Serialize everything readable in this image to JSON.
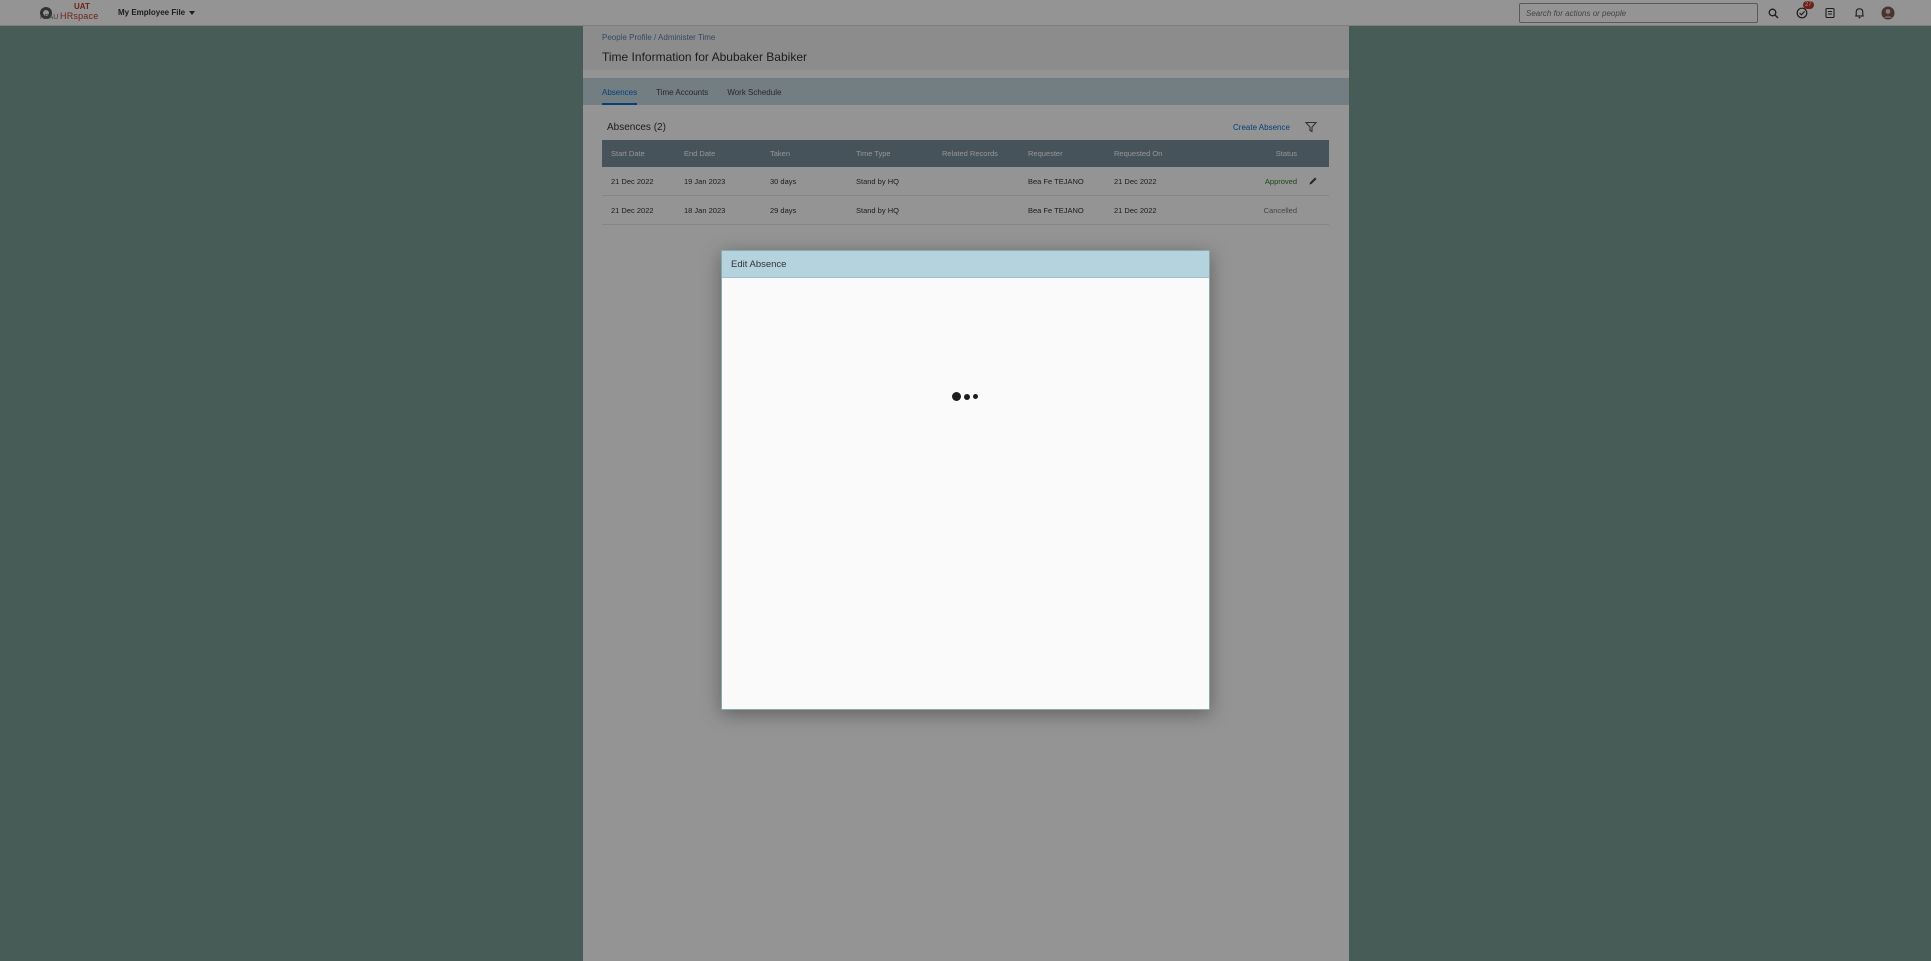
{
  "topbar": {
    "logo_org": "KFAU",
    "logo_uat": "UAT",
    "logo_app": "HRspace",
    "app_menu_label": "My Employee File",
    "search_placeholder": "Search for actions or people",
    "todo_badge_count": "27",
    "icons": [
      "search-icon",
      "todo-icon",
      "approvals-icon",
      "bell-icon",
      "avatar"
    ]
  },
  "page": {
    "breadcrumb": "People Profile / Administer Time",
    "title": "Time Information for Abubaker Babiker",
    "tabs": [
      {
        "label": "Absences",
        "active": true
      },
      {
        "label": "Time Accounts",
        "active": false
      },
      {
        "label": "Work Schedule",
        "active": false
      }
    ],
    "absences": {
      "title": "Absences (2)",
      "create_label": "Create Absence",
      "columns": [
        "Start Date",
        "End Date",
        "Taken",
        "Time Type",
        "Related Records",
        "Requester",
        "Requested On",
        "Status"
      ],
      "rows": [
        {
          "start": "21 Dec 2022",
          "end": "19 Jan 2023",
          "taken": "30 days",
          "type": "Stand by HQ",
          "related": "",
          "requester": "Bea Fe TEJANO",
          "requested_on": "21 Dec 2022",
          "status": "Approved",
          "editable": true
        },
        {
          "start": "21 Dec 2022",
          "end": "18 Jan 2023",
          "taken": "29 days",
          "type": "Stand by HQ",
          "related": "",
          "requester": "Bea Fe TEJANO",
          "requested_on": "21 Dec 2022",
          "status": "Cancelled",
          "editable": false
        }
      ]
    }
  },
  "dialog": {
    "title": "Edit Absence",
    "state": "loading"
  },
  "colors": {
    "background": "#7a9e96",
    "accent": "#0a6ed1",
    "table_header": "#7b8f9b",
    "dialog_header": "#b4d3df",
    "badge": "#c0392b"
  }
}
